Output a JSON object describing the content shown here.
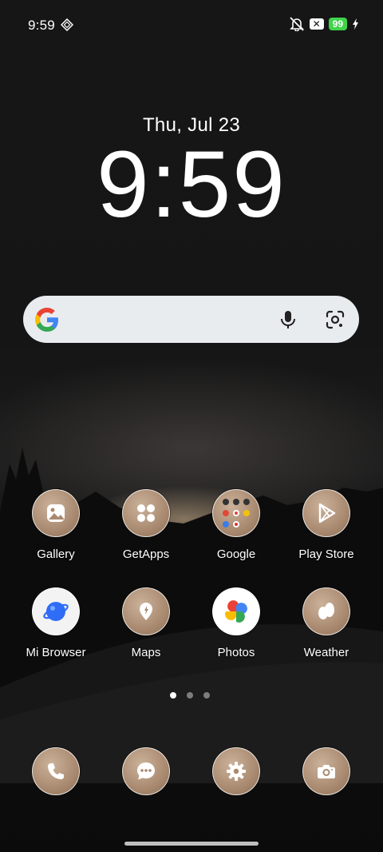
{
  "status_bar": {
    "time": "9:59",
    "battery_level": "99",
    "icons": [
      "diamond-icon",
      "mute-icon",
      "x-box-icon",
      "battery-icon",
      "charging-bolt-icon"
    ]
  },
  "clock_widget": {
    "date": "Thu, Jul 23",
    "time": "9:59"
  },
  "search_bar": {
    "icons": [
      "google-g-icon",
      "mic-icon",
      "google-lens-icon"
    ]
  },
  "apps": [
    {
      "label": "Gallery",
      "icon": "gallery-icon"
    },
    {
      "label": "GetApps",
      "icon": "getapps-icon"
    },
    {
      "label": "Google",
      "icon": "google-folder-icon"
    },
    {
      "label": "Play Store",
      "icon": "play-store-icon"
    },
    {
      "label": "Mi Browser",
      "icon": "mi-browser-icon"
    },
    {
      "label": "Maps",
      "icon": "maps-icon"
    },
    {
      "label": "Photos",
      "icon": "photos-icon"
    },
    {
      "label": "Weather",
      "icon": "weather-icon"
    }
  ],
  "page_indicator": {
    "pages": 3,
    "current": 1
  },
  "dock": [
    {
      "name": "phone",
      "icon": "phone-icon"
    },
    {
      "name": "messages",
      "icon": "messages-icon"
    },
    {
      "name": "settings",
      "icon": "settings-icon"
    },
    {
      "name": "camera",
      "icon": "camera-icon"
    }
  ],
  "colors": {
    "battery": "#3fd44a",
    "search_bg": "#e9ecef",
    "icon_tint": "#b39479"
  }
}
